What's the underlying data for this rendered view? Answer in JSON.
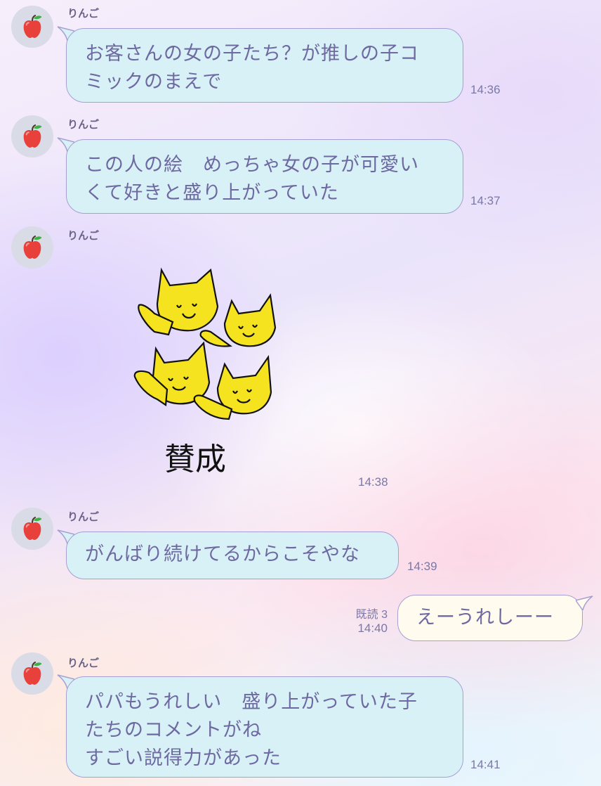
{
  "chat": {
    "messages": [
      {
        "sender": "りんご",
        "text": "お客さんの女の子たち？が推しの子コ\nミックのまえで",
        "time": "14:36"
      },
      {
        "sender": "りんご",
        "text": "この人の絵　めっちゃ女の子が可愛い\nくて好きと盛り上がっていた",
        "time": "14:37"
      },
      {
        "sender": "りんご",
        "sticker_icon": "cheering-cats-sticker",
        "sticker_text": "賛成",
        "time": "14:38"
      },
      {
        "sender": "りんご",
        "text": "がんばり続けてるからこそやな",
        "time": "14:39"
      },
      {
        "sender": "me",
        "text": "えーうれしーー",
        "read": "既読 3",
        "time": "14:40"
      },
      {
        "sender": "りんご",
        "text": "パパもうれしい　盛り上がっていた子\nたちのコメントがね\nすごい説得力があった",
        "time": "14:41"
      }
    ]
  },
  "colors": {
    "incoming_bubble": "#d8f1f7",
    "outgoing_bubble": "#fffbee",
    "bubble_border": "#a79fd2",
    "text": "#6e69a0",
    "sticker_cat": "#f5e31f"
  }
}
